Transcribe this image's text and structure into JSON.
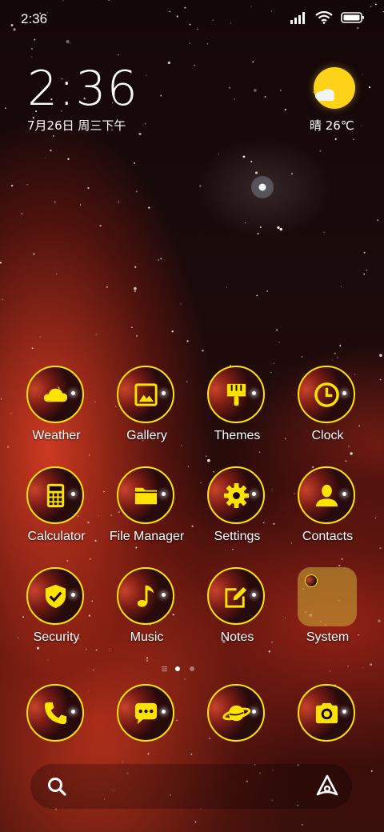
{
  "status_bar": {
    "time": "2:36"
  },
  "lock_clock": {
    "time": "2:36",
    "date": "7月26日 周三下午"
  },
  "weather": {
    "text": "晴 26℃"
  },
  "apps": [
    [
      {
        "label": "Weather",
        "icon": "weather-icon"
      },
      {
        "label": "Gallery",
        "icon": "gallery-icon"
      },
      {
        "label": "Themes",
        "icon": "themes-brush-icon"
      },
      {
        "label": "Clock",
        "icon": "clock-icon"
      }
    ],
    [
      {
        "label": "Calculator",
        "icon": "calculator-icon"
      },
      {
        "label": "File Manager",
        "icon": "folder-icon"
      },
      {
        "label": "Settings",
        "icon": "gear-icon"
      },
      {
        "label": "Contacts",
        "icon": "person-icon"
      }
    ],
    [
      {
        "label": "Security",
        "icon": "shield-check-icon"
      },
      {
        "label": "Music",
        "icon": "music-note-icon"
      },
      {
        "label": "Notes",
        "icon": "edit-note-icon"
      },
      {
        "label": "System",
        "icon": "folder-system"
      }
    ]
  ],
  "dock": [
    {
      "icon": "phone-icon"
    },
    {
      "icon": "message-icon"
    },
    {
      "icon": "planet-browser-icon"
    },
    {
      "icon": "camera-icon"
    }
  ],
  "colors": {
    "icon_yellow": "#ffe300",
    "sun": "#ffd21a"
  }
}
